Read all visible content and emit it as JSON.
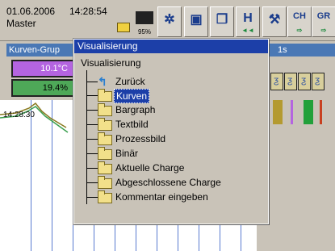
{
  "status": {
    "date": "01.06.2006",
    "user": "Master",
    "time": "14:28:54",
    "battery_percent": "95%"
  },
  "toolbar": {
    "btn_ch": "CH",
    "btn_gr": "GR",
    "btn_h": "H"
  },
  "background": {
    "group_title": "Kurven-Grup",
    "value1": "10.1°C",
    "value2": "19.4%",
    "plot_time": "14:28:30",
    "rate": "1s"
  },
  "popup": {
    "title": "Visualisierung",
    "root": "Visualisierung",
    "items": [
      {
        "label": "Zurück"
      },
      {
        "label": "Kurven",
        "selected": true
      },
      {
        "label": "Bargraph"
      },
      {
        "label": "Textbild"
      },
      {
        "label": "Prozessbild"
      },
      {
        "label": "Binär"
      },
      {
        "label": "Aktuelle Charge"
      },
      {
        "label": "Abgeschlossene Charge"
      },
      {
        "label": "Kommentar eingeben"
      }
    ]
  },
  "colors": {
    "popup_title": "#1c3fa8",
    "value1_bg": "#b464e0",
    "value2_bg": "#4ea858",
    "grid": "#5a7bd0"
  }
}
